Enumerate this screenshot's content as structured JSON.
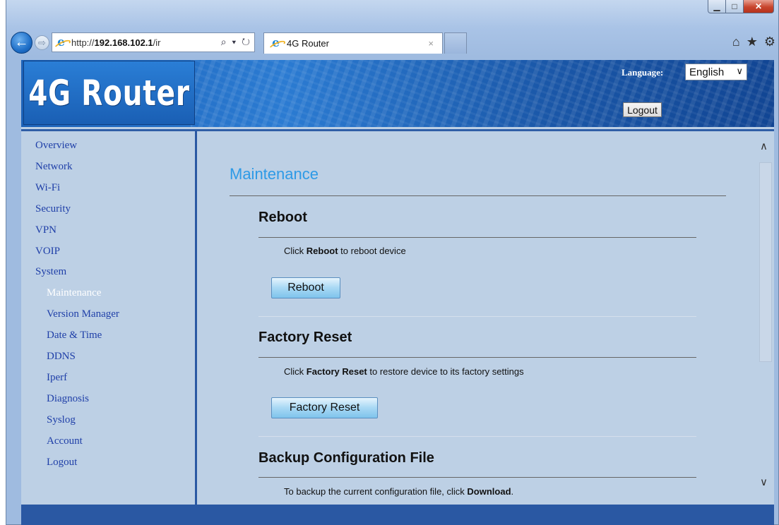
{
  "browser": {
    "address_prefix": "http://",
    "address_host": "192.168.102.1",
    "address_suffix": "/ir",
    "address_tools": "⌕ ▾ ↻",
    "tab_title": "4G Router",
    "tab_close": "×",
    "back_glyph": "←",
    "forward_glyph": "⇨",
    "minimize_glyph": "▁",
    "maximize_glyph": "□",
    "close_glyph": "✕",
    "home_glyph": "⌂",
    "favorites_glyph": "★",
    "settings_glyph": "⚙",
    "icons": [
      "back-icon",
      "forward-icon",
      "ie-logo-icon",
      "search-icon",
      "refresh-icon",
      "home-icon",
      "favorites-star-icon",
      "settings-gear-icon"
    ]
  },
  "header": {
    "logo_text": "4G Router",
    "language_label": "Language:",
    "language_value": "English",
    "language_chevron": "∨",
    "logout_label": "Logout"
  },
  "sidebar": {
    "items": [
      {
        "label": "Overview",
        "level": "top"
      },
      {
        "label": "Network",
        "level": "top"
      },
      {
        "label": "Wi-Fi",
        "level": "top"
      },
      {
        "label": "Security",
        "level": "top"
      },
      {
        "label": "VPN",
        "level": "top"
      },
      {
        "label": "VOIP",
        "level": "top"
      },
      {
        "label": "System",
        "level": "top"
      },
      {
        "label": "Maintenance",
        "level": "sub",
        "active": true
      },
      {
        "label": "Version Manager",
        "level": "sub"
      },
      {
        "label": "Date & Time",
        "level": "sub"
      },
      {
        "label": "DDNS",
        "level": "sub"
      },
      {
        "label": "Iperf",
        "level": "sub"
      },
      {
        "label": "Diagnosis",
        "level": "sub"
      },
      {
        "label": "Syslog",
        "level": "sub"
      },
      {
        "label": "Account",
        "level": "sub"
      },
      {
        "label": "Logout",
        "level": "sub"
      }
    ]
  },
  "main": {
    "page_title": "Maintenance",
    "reboot": {
      "title": "Reboot",
      "desc_pre": "Click ",
      "desc_bold": "Reboot",
      "desc_post": " to reboot device",
      "button": "Reboot"
    },
    "factory_reset": {
      "title": "Factory Reset",
      "desc_pre": "Click ",
      "desc_bold": "Factory Reset",
      "desc_post": " to restore device to its factory settings",
      "button": "Factory Reset"
    },
    "backup": {
      "title": "Backup Configuration File",
      "desc_pre": "To backup the current configuration file, click ",
      "desc_bold": "Download",
      "desc_post": "."
    }
  },
  "scrollbar": {
    "up_glyph": "∧",
    "down_glyph": "∨"
  },
  "colors": {
    "header_blue": "#1c62b8",
    "page_bg": "#bdd0e5",
    "nav_link": "#1f3fa8",
    "title_accent": "#2d9ae6",
    "button_gradient_top": "#e6f4fd",
    "button_gradient_bottom": "#7fc4ec"
  }
}
